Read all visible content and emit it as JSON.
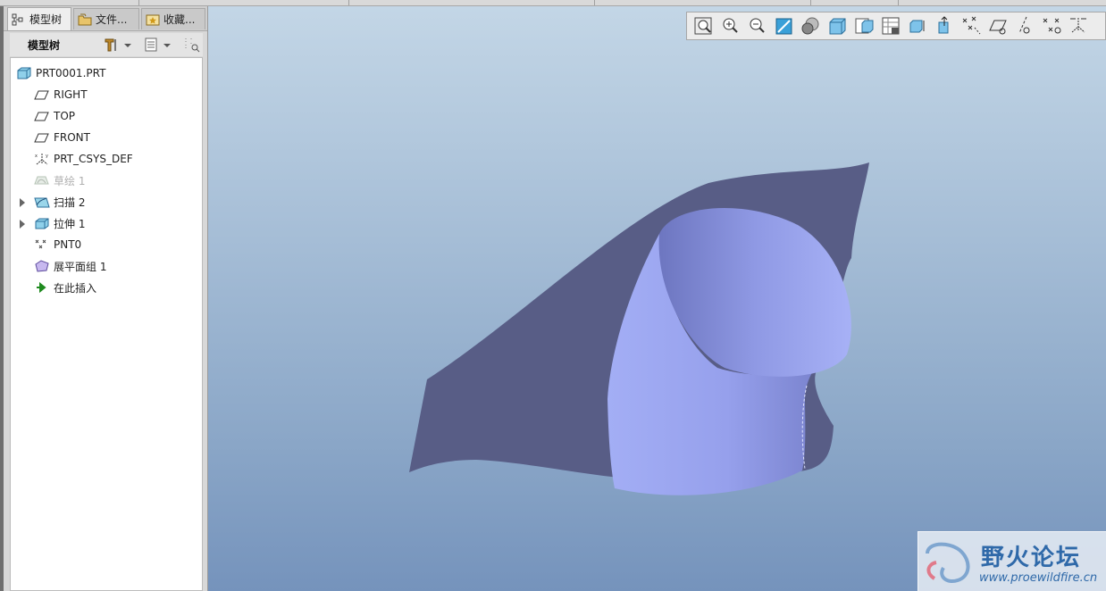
{
  "tabs": [
    {
      "label": "模型树",
      "active": true
    },
    {
      "label": "文件...",
      "active": false
    },
    {
      "label": "收藏...",
      "active": false
    }
  ],
  "tree_toolbar": {
    "label": "模型树"
  },
  "tree": [
    {
      "label": "PRT0001.PRT",
      "icon": "part-icon"
    },
    {
      "label": "RIGHT",
      "icon": "datum-plane-icon"
    },
    {
      "label": "TOP",
      "icon": "datum-plane-icon"
    },
    {
      "label": "FRONT",
      "icon": "datum-plane-icon"
    },
    {
      "label": "PRT_CSYS_DEF",
      "icon": "csys-icon"
    },
    {
      "label": "草绘 1",
      "icon": "sketch-icon",
      "dimmed": true
    },
    {
      "label": "扫描 2",
      "icon": "sweep-icon",
      "expandable": true
    },
    {
      "label": "拉伸 1",
      "icon": "extrude-icon",
      "expandable": true
    },
    {
      "label": "PNT0",
      "icon": "datum-point-icon"
    },
    {
      "label": "展平面组 1",
      "icon": "flatten-quilt-icon"
    },
    {
      "label": "在此插入",
      "icon": "insert-here-icon"
    }
  ],
  "view_toolbar": [
    "refit-icon",
    "zoom-in-icon",
    "zoom-out-icon",
    "repaint-icon",
    "shading-icon",
    "standard-orientation-icon",
    "previous-view-icon",
    "view-manager-icon",
    "saved-views-icon",
    "spin-center-icon",
    "planes-display-icon",
    "axes-display-icon",
    "points-display-icon",
    "csys-display-icon",
    "annotation-display-icon"
  ],
  "watermark": {
    "title": "野火论坛",
    "url": "www.proewildfire.cn"
  },
  "colors": {
    "quilt": "#585d86",
    "solid": "#9aa4ef",
    "solid_dark": "#6f78c2",
    "viewport_top": "#c3d6e6",
    "viewport_bottom": "#7593bc"
  }
}
